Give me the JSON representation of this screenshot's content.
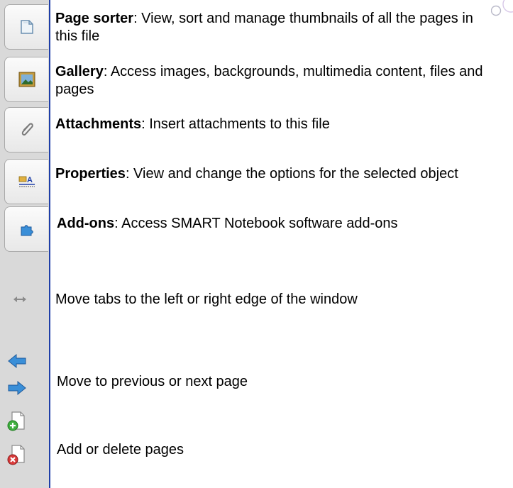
{
  "tabs": [
    {
      "title": "Page sorter",
      "description": ": View, sort and manage thumbnails of all the pages in this file"
    },
    {
      "title": "Gallery",
      "description": ": Access images, backgrounds, multimedia content, files and pages"
    },
    {
      "title": "Attachments",
      "description": ": Insert attachments to this file"
    },
    {
      "title": "Properties",
      "description": ": View and change the options for the selected object"
    },
    {
      "title": "Add-ons",
      "description": ": Access SMART Notebook software add-ons"
    }
  ],
  "controls": {
    "move_tabs": "Move tabs to the left or right edge of the window",
    "prev_next": "Move to previous or next page",
    "add_delete": "Add or delete pages"
  },
  "colors": {
    "sidebar": "#d9d9d9",
    "divider": "#1f3fa8",
    "arrow": "#3a8fd8",
    "add": "#3fae3f",
    "delete": "#d83a3a"
  }
}
